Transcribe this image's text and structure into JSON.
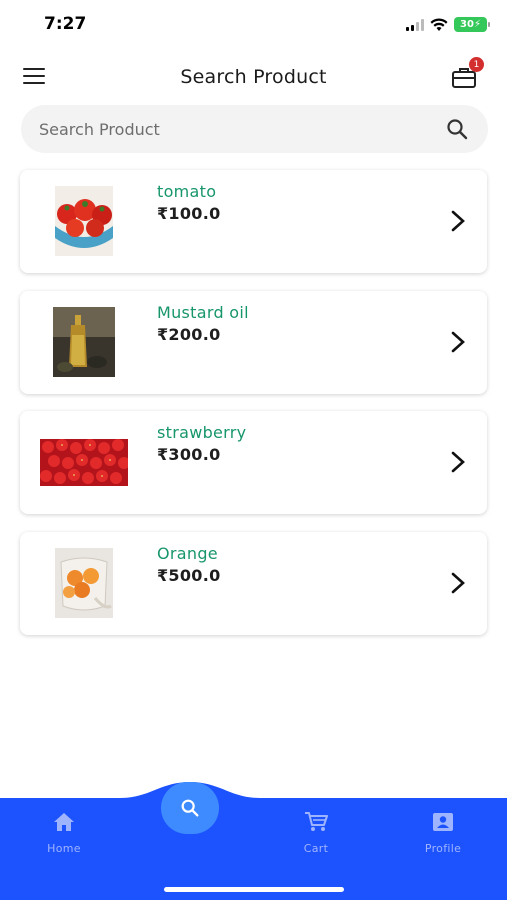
{
  "status": {
    "time": "7:27",
    "battery": "30"
  },
  "header": {
    "title": "Search Product",
    "cart_badge": "1"
  },
  "search": {
    "placeholder": "Search Product"
  },
  "products": [
    {
      "name": "tomato",
      "price": "₹100.0"
    },
    {
      "name": "Mustard oil",
      "price": "₹200.0"
    },
    {
      "name": "strawberry",
      "price": "₹300.0"
    },
    {
      "name": "Orange",
      "price": "₹500.0"
    }
  ],
  "nav": {
    "home": "Home",
    "cart": "Cart",
    "profile": "Profile"
  },
  "colors": {
    "accent_green": "#17966b",
    "nav_blue": "#1d53ff",
    "fab_blue": "#3d8bff",
    "badge_red": "#d32f2f"
  }
}
